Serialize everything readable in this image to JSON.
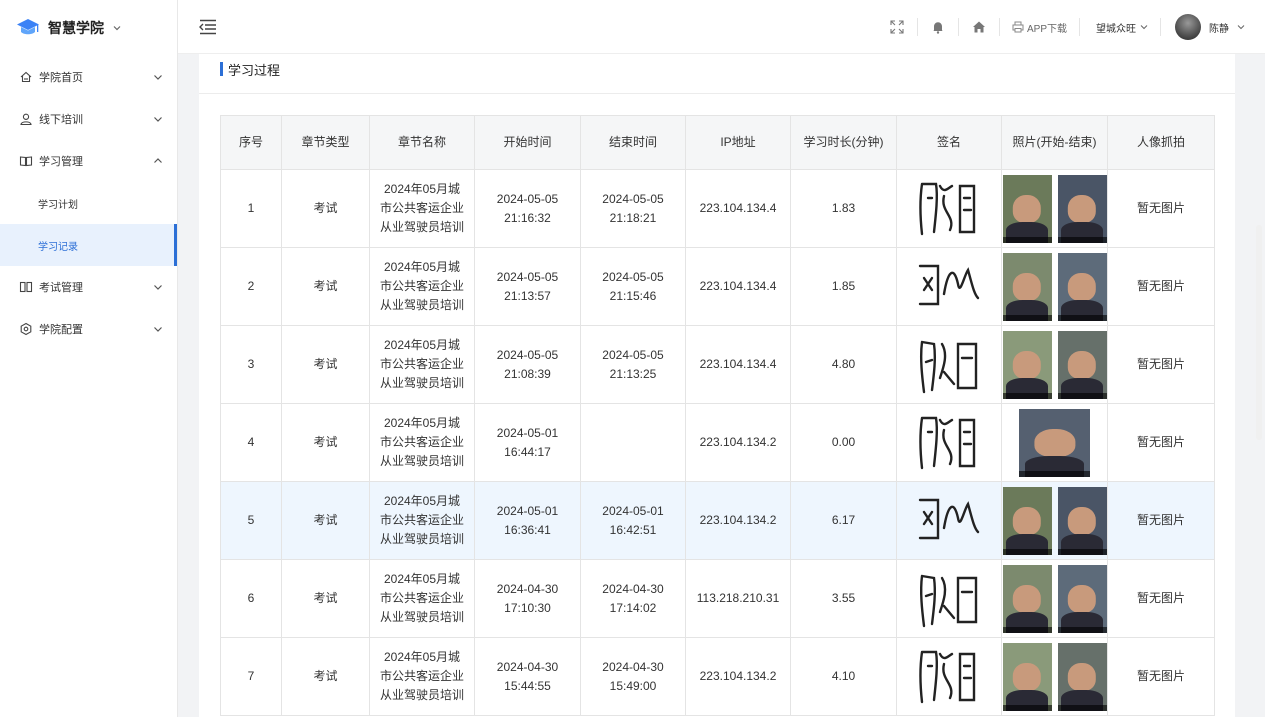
{
  "brand": {
    "title": "智慧学院"
  },
  "sidebar": {
    "items": [
      {
        "label": "学院首页",
        "icon": "home-outline-icon",
        "expanded": false
      },
      {
        "label": "线下培训",
        "icon": "user-icon",
        "expanded": false
      },
      {
        "label": "学习管理",
        "icon": "book-icon",
        "expanded": true,
        "children": [
          {
            "label": "学习计划",
            "active": false
          },
          {
            "label": "学习记录",
            "active": true
          }
        ]
      },
      {
        "label": "考试管理",
        "icon": "exam-icon",
        "expanded": false
      },
      {
        "label": "学院配置",
        "icon": "settings-icon",
        "expanded": false
      }
    ]
  },
  "header": {
    "app_download": "APP下载",
    "org": "望城众旺",
    "user": "陈静"
  },
  "section": {
    "title": "学习过程"
  },
  "table": {
    "headers": [
      "序号",
      "章节类型",
      "章节名称",
      "开始时间",
      "结束时间",
      "IP地址",
      "学习时长(分钟)",
      "签名",
      "照片(开始-结束)",
      "人像抓拍"
    ],
    "rows": [
      {
        "no": "1",
        "type": "考试",
        "name": "2024年05月城市公共客运企业从业驾驶员培训",
        "start": "2024-05-05 21:16:32",
        "end": "2024-05-05 21:18:21",
        "ip": "223.104.134.4",
        "duration": "1.83",
        "capture": "暂无图片",
        "photos": 2,
        "highlight": false
      },
      {
        "no": "2",
        "type": "考试",
        "name": "2024年05月城市公共客运企业从业驾驶员培训",
        "start": "2024-05-05 21:13:57",
        "end": "2024-05-05 21:15:46",
        "ip": "223.104.134.4",
        "duration": "1.85",
        "capture": "暂无图片",
        "photos": 2,
        "highlight": false
      },
      {
        "no": "3",
        "type": "考试",
        "name": "2024年05月城市公共客运企业从业驾驶员培训",
        "start": "2024-05-05 21:08:39",
        "end": "2024-05-05 21:13:25",
        "ip": "223.104.134.4",
        "duration": "4.80",
        "capture": "暂无图片",
        "photos": 2,
        "highlight": false
      },
      {
        "no": "4",
        "type": "考试",
        "name": "2024年05月城市公共客运企业从业驾驶员培训",
        "start": "2024-05-01 16:44:17",
        "end": "",
        "ip": "223.104.134.2",
        "duration": "0.00",
        "capture": "暂无图片",
        "photos": 1,
        "highlight": false
      },
      {
        "no": "5",
        "type": "考试",
        "name": "2024年05月城市公共客运企业从业驾驶员培训",
        "start": "2024-05-01 16:36:41",
        "end": "2024-05-01 16:42:51",
        "ip": "223.104.134.2",
        "duration": "6.17",
        "capture": "暂无图片",
        "photos": 2,
        "highlight": true
      },
      {
        "no": "6",
        "type": "考试",
        "name": "2024年05月城市公共客运企业从业驾驶员培训",
        "start": "2024-04-30 17:10:30",
        "end": "2024-04-30 17:14:02",
        "ip": "113.218.210.31",
        "duration": "3.55",
        "capture": "暂无图片",
        "photos": 2,
        "highlight": false
      },
      {
        "no": "7",
        "type": "考试",
        "name": "2024年05月城市公共客运企业从业驾驶员培训",
        "start": "2024-04-30 15:44:55",
        "end": "2024-04-30 15:49:00",
        "ip": "223.104.134.2",
        "duration": "4.10",
        "capture": "暂无图片",
        "photos": 2,
        "highlight": false
      }
    ]
  }
}
